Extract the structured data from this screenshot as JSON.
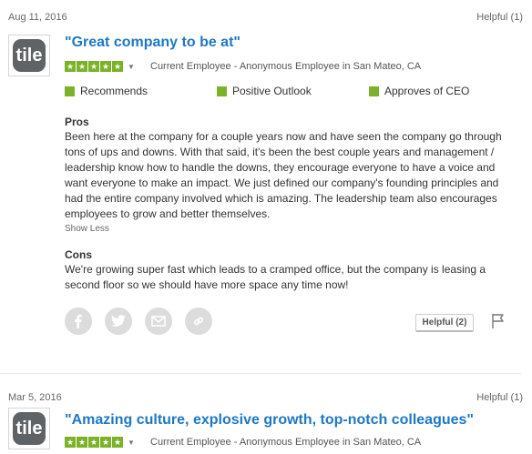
{
  "reviews": [
    {
      "date": "Aug 11, 2016",
      "helpful_top": "Helpful (1)",
      "logo_text": "tile",
      "title": "\"Great company to be at\"",
      "rating_stars": 5,
      "employee": "Current Employee - Anonymous Employee in San Mateo, CA",
      "badges": [
        "Recommends",
        "Positive Outlook",
        "Approves of CEO"
      ],
      "pros_title": "Pros",
      "pros_lines": [
        "Been here at the company for a couple years now and have seen the company go through",
        "tons of ups and downs. With that said, it's been the best couple years and management /",
        "leadership know how to handle the downs, they encourage everyone to have a voice and",
        "want everyone to make an impact. We just defined our company's founding principles and",
        "had the entire company involved which is amazing. The leadership team also encourages",
        "employees to grow and better themselves."
      ],
      "show_less": "Show Less",
      "cons_title": "Cons",
      "cons_lines": [
        "We're growing super fast which leads to a cramped office, but the company is leasing a",
        "second floor so we should have more space any time now!"
      ],
      "helpful_button": "Helpful (2)",
      "social_icons": [
        "facebook-icon",
        "twitter-icon",
        "email-icon",
        "link-icon"
      ]
    },
    {
      "date": "Mar 5, 2016",
      "helpful_top": "Helpful (1)",
      "logo_text": "tile",
      "title": "\"Amazing culture, explosive growth, top-notch colleagues\"",
      "rating_stars": 5,
      "employee": "Current Employee - Anonymous Employee in San Mateo, CA"
    }
  ],
  "colors": {
    "title": "#1e78c2",
    "star_green": "#7cb228",
    "logo_bg": "#5f6366",
    "icon_circle": "#dcdcdc"
  }
}
